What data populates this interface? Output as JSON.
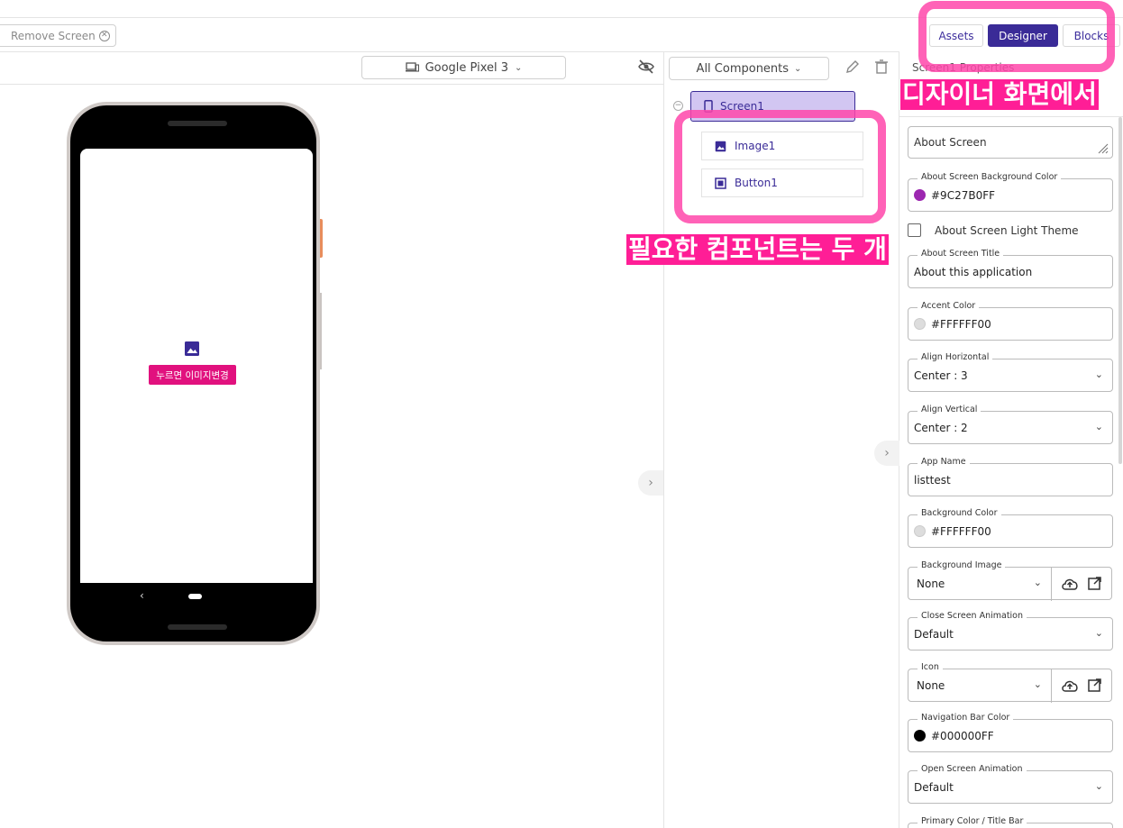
{
  "toolbar": {
    "remove_screen_label": "Remove Screen",
    "modes": {
      "assets": "Assets",
      "designer": "Designer",
      "blocks": "Blocks"
    }
  },
  "viewer": {
    "device_select": "Google Pixel 3",
    "phone": {
      "button_text": "누르면 이미지변경"
    }
  },
  "components": {
    "filter_select": "All Components",
    "tree": {
      "screen": "Screen1",
      "items": [
        "Image1",
        "Button1"
      ]
    }
  },
  "properties": {
    "title": "Screen1 Properties",
    "about_screen": {
      "placeholder": "About Screen"
    },
    "about_bg_color": {
      "label": "About Screen Background Color",
      "value": "#9C27B0FF",
      "swatch": "#9c27b0"
    },
    "about_light_theme": {
      "label": "About Screen Light Theme"
    },
    "about_title": {
      "label": "About Screen Title",
      "value": "About this application"
    },
    "accent_color": {
      "label": "Accent Color",
      "value": "#FFFFFF00",
      "swatch": "#dddddd"
    },
    "align_horizontal": {
      "label": "Align Horizontal",
      "value": "Center : 3"
    },
    "align_vertical": {
      "label": "Align Vertical",
      "value": "Center : 2"
    },
    "app_name": {
      "label": "App Name",
      "value": "listtest"
    },
    "background_color": {
      "label": "Background Color",
      "value": "#FFFFFF00",
      "swatch": "#dddddd"
    },
    "background_image": {
      "label": "Background Image",
      "value": "None"
    },
    "close_animation": {
      "label": "Close Screen Animation",
      "value": "Default"
    },
    "icon": {
      "label": "Icon",
      "value": "None"
    },
    "nav_bar_color": {
      "label": "Navigation Bar Color",
      "value": "#000000FF",
      "swatch": "#000000"
    },
    "open_animation": {
      "label": "Open Screen Animation",
      "value": "Default"
    },
    "primary_color": {
      "label": "Primary Color / Title Bar"
    }
  },
  "annotations": {
    "caption_designer": "디자이너 화면에서",
    "caption_components": "필요한 컴포넌트는 두 개"
  },
  "colors": {
    "accent": "#3a2b97",
    "highlight": "#ff1e96",
    "button": "#e1117e",
    "screen_selected": "#d2c6f2"
  }
}
